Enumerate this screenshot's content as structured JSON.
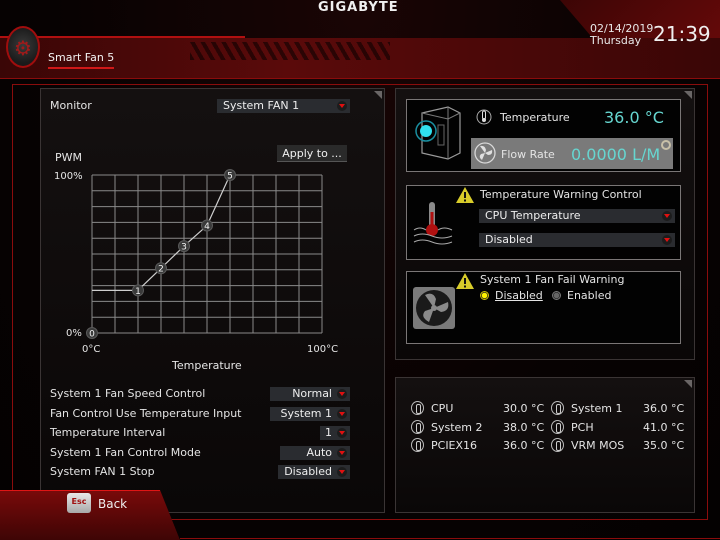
{
  "header": {
    "brand": "GIGABYTE",
    "page_tab": "Smart Fan 5",
    "date": "02/14/2019",
    "weekday": "Thursday",
    "time": "21:39"
  },
  "left": {
    "monitor_label": "Monitor",
    "monitor_value": "System FAN 1",
    "apply_button": "Apply to ...",
    "settings": [
      {
        "label": "System 1 Fan Speed Control",
        "value": "Normal"
      },
      {
        "label": "Fan Control Use Temperature Input",
        "value": "System 1"
      },
      {
        "label": "Temperature Interval",
        "value": "1"
      },
      {
        "label": "System 1 Fan Control Mode",
        "value": "Auto"
      },
      {
        "label": "System FAN 1 Stop",
        "value": "Disabled"
      }
    ]
  },
  "chart_data": {
    "type": "line",
    "title": "",
    "ylabel": "PWM",
    "xlabel": "Temperature",
    "x_tick_labels": [
      "0°C",
      "100°C"
    ],
    "y_tick_labels": [
      "0%",
      "100%"
    ],
    "xlim": [
      0,
      100
    ],
    "ylim": [
      0,
      100
    ],
    "grid": true,
    "grid_divisions": 10,
    "points": [
      {
        "label": "0",
        "x": 0,
        "y": 0
      },
      {
        "label": "1",
        "x": 20,
        "y": 27
      },
      {
        "label": "2",
        "x": 30,
        "y": 41
      },
      {
        "label": "3",
        "x": 40,
        "y": 55
      },
      {
        "label": "4",
        "x": 50,
        "y": 68
      },
      {
        "label": "5",
        "x": 60,
        "y": 100
      }
    ],
    "flat_segment_from_x": 0,
    "flat_segment_y": 27
  },
  "right": {
    "temperature_label": "Temperature",
    "temperature_value": "36.0 °C",
    "flow_label": "Flow Rate",
    "flow_value": "0.0000 L/M",
    "warning_title": "Temperature Warning Control",
    "warning_source": "CPU Temperature",
    "warning_state": "Disabled",
    "fail_title": "System 1 Fan Fail Warning",
    "fail_options": [
      {
        "label": "Disabled",
        "selected": true
      },
      {
        "label": "Enabled",
        "selected": false
      }
    ],
    "sensors": [
      {
        "name": "CPU",
        "value": "30.0 °C"
      },
      {
        "name": "System 1",
        "value": "36.0 °C"
      },
      {
        "name": "System 2",
        "value": "38.0 °C"
      },
      {
        "name": "PCH",
        "value": "41.0 °C"
      },
      {
        "name": "PCIEX16",
        "value": "36.0 °C"
      },
      {
        "name": "VRM MOS",
        "value": "35.0 °C"
      }
    ]
  },
  "footer": {
    "esc_key": "Esc",
    "back_label": "Back"
  },
  "colors": {
    "accent_red": "#d01818",
    "value_cyan": "#66d6d0",
    "warning_yellow": "#d4c400"
  }
}
